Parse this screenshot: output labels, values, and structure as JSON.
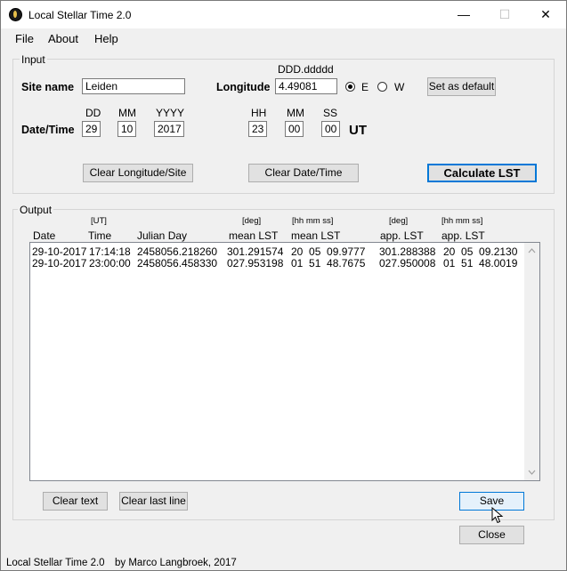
{
  "window": {
    "title": "Local Stellar Time 2.0",
    "minimize": "—",
    "maximize": "☐",
    "close": "✕"
  },
  "menu": {
    "items": [
      "File",
      "About",
      "Help"
    ]
  },
  "input": {
    "group_title": "Input",
    "site_label": "Site name",
    "site_value": "Leiden",
    "longitude_format": "DDD.ddddd",
    "longitude_label": "Longitude",
    "longitude_value": "4.49081",
    "east_label": "E",
    "west_label": "W",
    "east_selected": true,
    "set_default_label": "Set as default",
    "datetime_label": "Date/Time",
    "dd_label": "DD",
    "mm_label": "MM",
    "yyyy_label": "YYYY",
    "hh_label": "HH",
    "min_label": "MM",
    "ss_label": "SS",
    "dd_value": "29",
    "mm_value": "10",
    "yyyy_value": "2017",
    "hh_value": "23",
    "min_value": "00",
    "ss_value": "00",
    "ut_label": "UT",
    "clear_long_site_label": "Clear Longitude/Site",
    "clear_datetime_label": "Clear Date/Time",
    "calculate_label": "Calculate LST"
  },
  "output": {
    "group_title": "Output",
    "units": {
      "time": "[UT]",
      "mean_deg": "[deg]",
      "mean_hms": "[hh mm ss]",
      "app_deg": "[deg]",
      "app_hms": "[hh mm ss]"
    },
    "columns": [
      "Date",
      "Time",
      "Julian Day",
      "mean LST",
      "mean LST",
      "app. LST",
      "app. LST"
    ],
    "rows": [
      [
        "29-10-2017",
        "17:14:18",
        "2458056.218260",
        "301.291574",
        "20  05  09.9777",
        "301.288388",
        "20  05  09.2130"
      ],
      [
        "29-10-2017",
        "23:00:00",
        "2458056.458330",
        "027.953198",
        "01  51  48.7675",
        "027.950008",
        "01  51  48.0019"
      ]
    ],
    "clear_text_label": "Clear text",
    "clear_last_line_label": "Clear last line",
    "save_label": "Save",
    "close_label": "Close"
  },
  "status": {
    "app": "Local Stellar Time 2.0",
    "author": "by Marco Langbroek, 2017"
  }
}
